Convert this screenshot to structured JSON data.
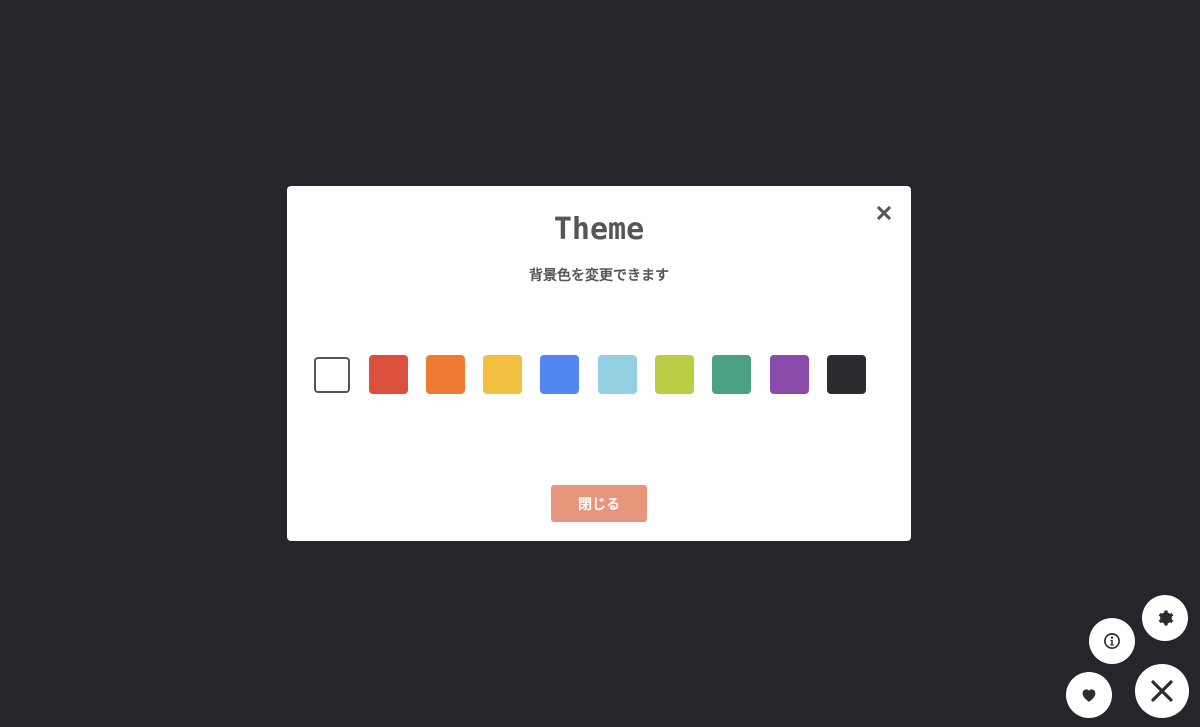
{
  "modal": {
    "title": "Theme",
    "subtitle": "背景色を変更できます",
    "close_icon": "close-icon",
    "close_button_label": "閉じる"
  },
  "swatches": [
    {
      "name": "white",
      "color": "#ffffff",
      "selected": true
    },
    {
      "name": "red",
      "color": "#db4f3d"
    },
    {
      "name": "orange",
      "color": "#ee7b30"
    },
    {
      "name": "yellow",
      "color": "#f2bf40"
    },
    {
      "name": "blue",
      "color": "#5187ee"
    },
    {
      "name": "light-blue",
      "color": "#92cfe1"
    },
    {
      "name": "lime",
      "color": "#bbcd44"
    },
    {
      "name": "teal",
      "color": "#4ba184"
    },
    {
      "name": "purple",
      "color": "#8a4aaa"
    },
    {
      "name": "dark",
      "color": "#2b2c30"
    }
  ],
  "fab": {
    "settings_icon": "gear-icon",
    "info_icon": "info-icon",
    "like_icon": "heart-icon",
    "close_icon": "close-icon"
  },
  "colors": {
    "background": "#25262b",
    "modal": "#ffffff",
    "text": "#555659",
    "button": "#e5967c"
  }
}
